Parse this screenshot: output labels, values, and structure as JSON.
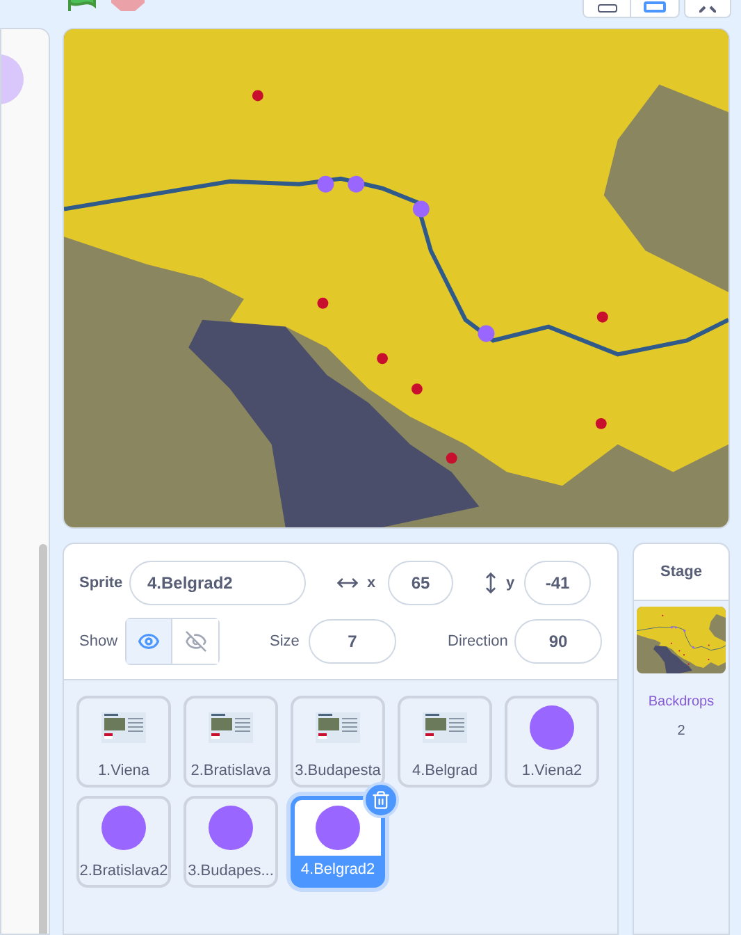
{
  "sprite_info": {
    "sprite_label": "Sprite",
    "sprite_name": "4.Belgrad2",
    "x_label": "x",
    "x_value": "65",
    "y_label": "y",
    "y_value": "-41",
    "show_label": "Show",
    "visible": true,
    "size_label": "Size",
    "size_value": "7",
    "direction_label": "Direction",
    "direction_value": "90"
  },
  "sprites": [
    {
      "name": "1.Viena",
      "kind": "slide",
      "selected": false
    },
    {
      "name": "2.Bratislava",
      "kind": "slide",
      "selected": false
    },
    {
      "name": "3.Budapesta",
      "kind": "slide",
      "selected": false
    },
    {
      "name": "4.Belgrad",
      "kind": "slide",
      "selected": false
    },
    {
      "name": "1.Viena2",
      "kind": "dot",
      "selected": false
    },
    {
      "name": "2.Bratislava2",
      "kind": "dot",
      "selected": false
    },
    {
      "name": "3.Budapes...",
      "kind": "dot",
      "selected": false
    },
    {
      "name": "4.Belgrad2",
      "kind": "dot",
      "selected": true
    }
  ],
  "stage_pane": {
    "title": "Stage",
    "backdrops_label": "Backdrops",
    "backdrops_count": "2"
  }
}
